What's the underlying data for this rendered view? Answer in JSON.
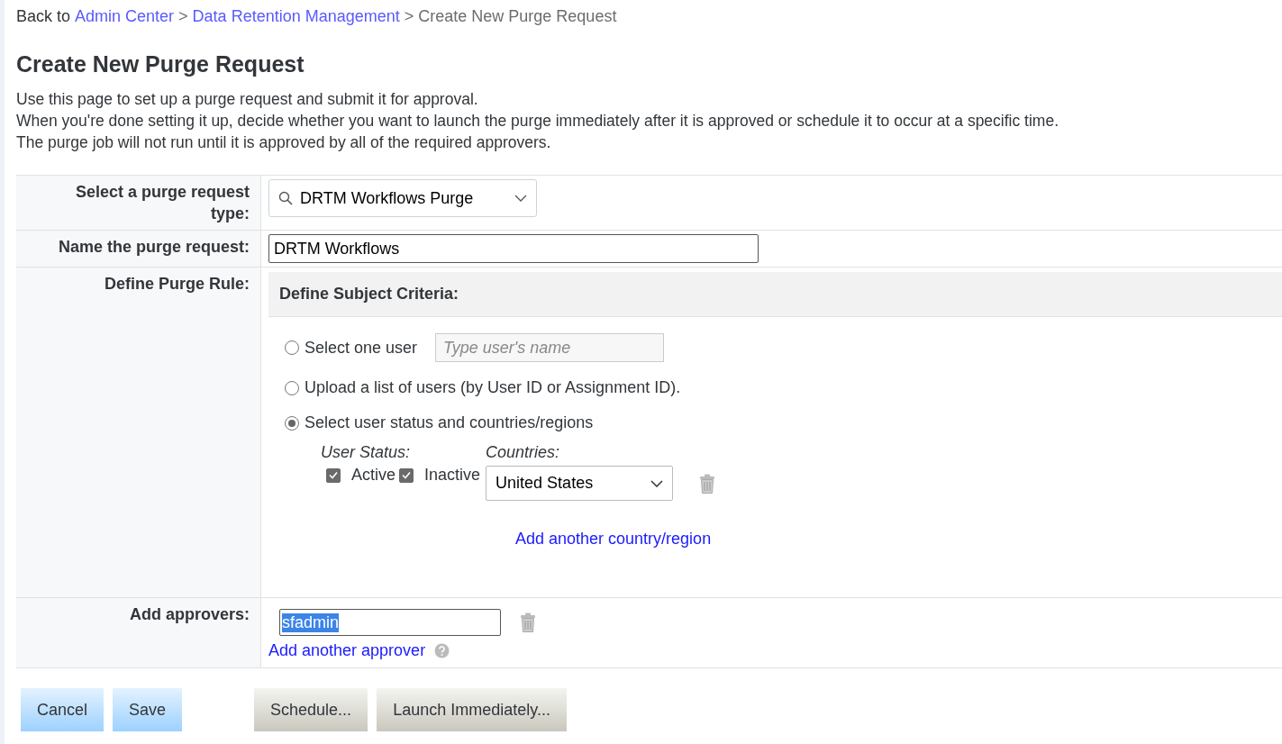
{
  "breadcrumb": {
    "prefix": "Back to",
    "links": [
      "Admin Center",
      "Data Retention Management"
    ],
    "separator": ">",
    "current": "Create New Purge Request"
  },
  "title": "Create New Purge Request",
  "intro": [
    "Use this page to set up a purge request and submit it for approval.",
    "When you're done setting it up, decide whether you want to launch the purge immediately after it is approved or schedule it to occur at a specific time.",
    "The purge job will not run until it is approved by all of the required approvers."
  ],
  "form": {
    "request_type": {
      "label": "Select a purge request type:",
      "value": "DRTM Workflows Purge"
    },
    "name": {
      "label": "Name the purge request:",
      "value": "DRTM Workflows"
    },
    "rule": {
      "label": "Define Purge Rule:",
      "section_title": "Define Subject Criteria:",
      "options": [
        {
          "kind": "user",
          "label": "Select one user",
          "placeholder": "Type user's name",
          "selected": false
        },
        {
          "kind": "upload",
          "label": "Upload a list of users (by User ID or Assignment ID).",
          "selected": false
        },
        {
          "kind": "status",
          "label": "Select user status and countries/regions",
          "selected": true
        }
      ],
      "status_label": "User Status:",
      "statuses": [
        {
          "label": "Active",
          "checked": true
        },
        {
          "label": "Inactive",
          "checked": true
        }
      ],
      "countries_label": "Countries:",
      "country": "United States",
      "add_country": "Add another country/region"
    },
    "approvers": {
      "label": "Add approvers:",
      "value": "sfadmin",
      "text_selected": true,
      "add_link": "Add another approver"
    }
  },
  "buttons": [
    {
      "label": "Cancel",
      "kind": "primary"
    },
    {
      "label": "Save",
      "kind": "primary"
    },
    {
      "label": "Schedule...",
      "kind": "secondary"
    },
    {
      "label": "Launch Immediately...",
      "kind": "secondary"
    }
  ]
}
